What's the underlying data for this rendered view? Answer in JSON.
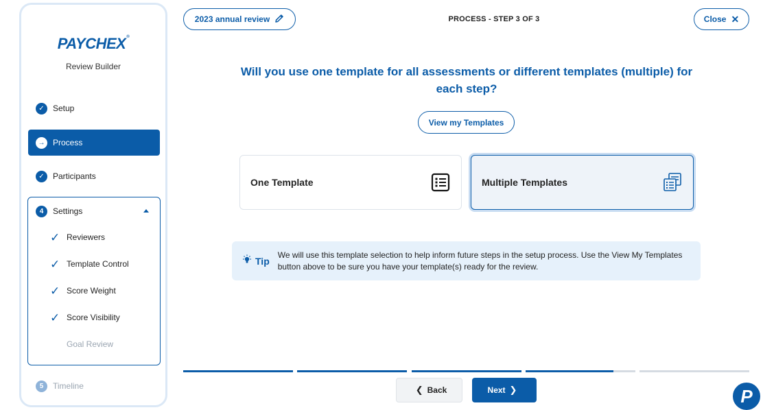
{
  "sidebar": {
    "logo": "PAYCHEX",
    "logo_mark": "®",
    "subtitle": "Review Builder",
    "items": [
      {
        "label": "Setup",
        "state": "done"
      },
      {
        "label": "Process",
        "state": "active"
      },
      {
        "label": "Participants",
        "state": "done"
      },
      {
        "label": "Settings",
        "number": "4",
        "state": "expanded"
      },
      {
        "label": "Timeline",
        "number": "5",
        "state": "disabled"
      }
    ],
    "settings_sub": [
      {
        "label": "Reviewers",
        "done": true
      },
      {
        "label": "Template Control",
        "done": true
      },
      {
        "label": "Score Weight",
        "done": true
      },
      {
        "label": "Score Visibility",
        "done": true
      },
      {
        "label": "Goal Review",
        "done": false
      }
    ]
  },
  "header": {
    "review_name": "2023 annual review",
    "step_label": "PROCESS - STEP 3 OF 3",
    "close_label": "Close"
  },
  "main": {
    "question": "Will you use one template for all assessments or different templates (multiple) for each step?",
    "view_templates_label": "View my Templates",
    "cards": [
      {
        "label": "One Template",
        "selected": false,
        "icon": "list-icon"
      },
      {
        "label": "Multiple Templates",
        "selected": true,
        "icon": "multi-list-icon"
      }
    ],
    "tip_label": "Tip",
    "tip_text": "We will use this template selection to help inform future steps in the setup process. Use the View My Templates button above to be sure you have your template(s) ready for the review."
  },
  "progress": {
    "segments": [
      1,
      1,
      1,
      0.8,
      0
    ]
  },
  "footer": {
    "back_label": "Back",
    "next_label": "Next"
  },
  "help": {
    "fab_label": "P"
  },
  "colors": {
    "brand": "#0b5ca8",
    "tip_bg": "#e6f1fb",
    "selected_card_bg": "#eef3f9"
  }
}
